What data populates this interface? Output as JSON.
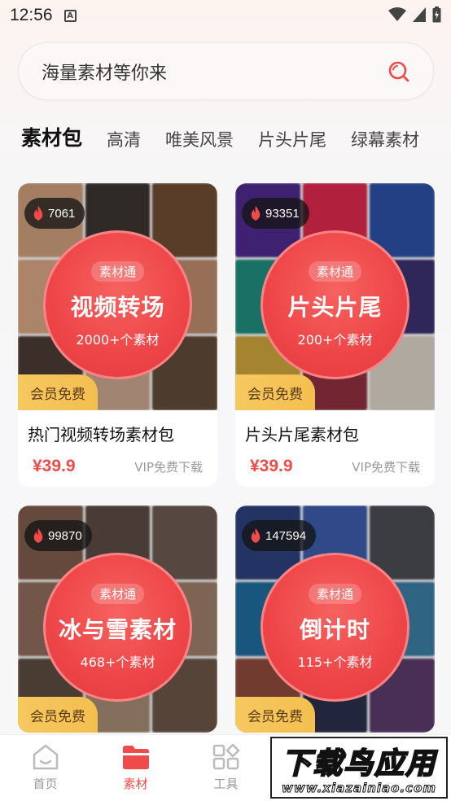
{
  "status_bar": {
    "time": "12:56"
  },
  "search": {
    "placeholder": "海量素材等你来"
  },
  "tabs": [
    {
      "label": "素材包",
      "active": true
    },
    {
      "label": "高清",
      "active": false
    },
    {
      "label": "唯美风景",
      "active": false
    },
    {
      "label": "片头片尾",
      "active": false
    },
    {
      "label": "绿幕素材",
      "active": false
    }
  ],
  "cards": [
    {
      "heat": "7061",
      "tag": "素材通",
      "circle_title": "视频转场",
      "circle_sub": "2000+个素材",
      "badge": "会员免费",
      "title": "热门视频转场素材包",
      "price": "¥39.9",
      "vip": "VIP免费下载"
    },
    {
      "heat": "93351",
      "tag": "素材通",
      "circle_title": "片头片尾",
      "circle_sub": "200+个素材",
      "badge": "会员免费",
      "title": "片头片尾素材包",
      "price": "¥39.9",
      "vip": "VIP免费下载"
    },
    {
      "heat": "99870",
      "tag": "素材通",
      "circle_title": "冰与雪素材",
      "circle_sub": "468+个素材",
      "badge": "会员免费"
    },
    {
      "heat": "147594",
      "tag": "素材通",
      "circle_title": "倒计时",
      "circle_sub": "115+个素材",
      "badge": "会员免费"
    }
  ],
  "bottom_nav": [
    {
      "label": "首页",
      "icon": "home-icon",
      "active": false
    },
    {
      "label": "素材",
      "icon": "folder-icon",
      "active": true
    },
    {
      "label": "工具",
      "icon": "tools-grid-icon",
      "active": false
    }
  ],
  "watermark": {
    "main": "下载鸟应用",
    "domain": "www.xiazainiao.com"
  },
  "colors": {
    "accent": "#f04a4a",
    "vip_badge": "#f3bf4f",
    "circle": "#ee4548"
  }
}
